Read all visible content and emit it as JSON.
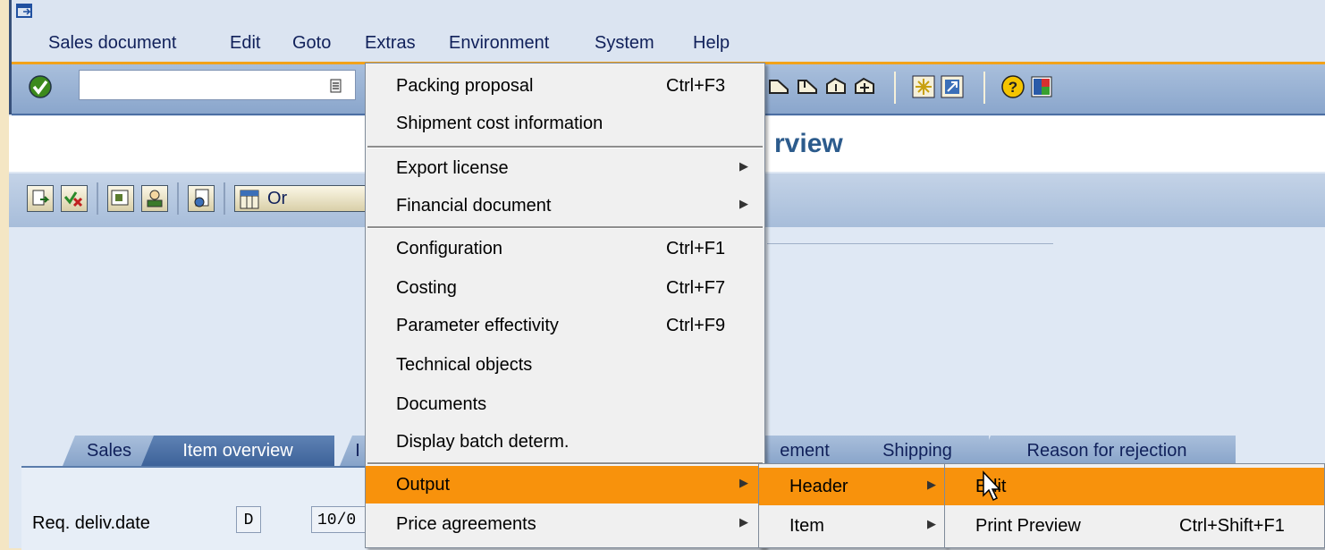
{
  "menubar": {
    "items": [
      "Sales document",
      "Edit",
      "Goto",
      "Extras",
      "Environment",
      "System",
      "Help"
    ]
  },
  "title": {
    "visible_fragment": "rview"
  },
  "app_toolbar": {
    "orders_label": "Or"
  },
  "extras_menu": {
    "items": [
      {
        "label": "Packing proposal",
        "shortcut": "Ctrl+F3"
      },
      {
        "label": "Shipment cost information",
        "shortcut": ""
      },
      {
        "label": "Export license",
        "shortcut": "",
        "submenu": true
      },
      {
        "label": "Financial document",
        "shortcut": "",
        "submenu": true
      },
      {
        "label": "Configuration",
        "shortcut": "Ctrl+F1"
      },
      {
        "label": "Costing",
        "shortcut": "Ctrl+F7"
      },
      {
        "label": "Parameter effectivity",
        "shortcut": "Ctrl+F9"
      },
      {
        "label": "Technical objects",
        "shortcut": ""
      },
      {
        "label": "Documents",
        "shortcut": ""
      },
      {
        "label": "Display batch determ.",
        "shortcut": ""
      },
      {
        "label": "Output",
        "shortcut": "",
        "submenu": true,
        "highlighted": true
      },
      {
        "label": "Price agreements",
        "shortcut": "",
        "submenu": true
      }
    ]
  },
  "output_menu": {
    "items": [
      {
        "label": "Header",
        "submenu": true,
        "highlighted": true
      },
      {
        "label": "Item",
        "submenu": true
      }
    ]
  },
  "header_menu": {
    "items": [
      {
        "label": "Edit",
        "shortcut": "",
        "highlighted": true
      },
      {
        "label": "Print Preview",
        "shortcut": "Ctrl+Shift+F1"
      }
    ]
  },
  "tabs": [
    {
      "label": "Sales",
      "active": false
    },
    {
      "label": "Item overview",
      "active": true
    },
    {
      "label": "I",
      "active": false
    },
    {
      "label": "ement",
      "active": false
    },
    {
      "label": "Shipping",
      "active": false
    },
    {
      "label": "Reason for rejection",
      "active": false
    }
  ],
  "fields": {
    "req_deliv_date_label": "Req. deliv.date",
    "req_deliv_date_format": "D",
    "req_deliv_date_value": "10/0"
  },
  "colors": {
    "highlight": "#f8920c",
    "accent_line": "#f2a21a",
    "title": "#2c5b8c"
  }
}
